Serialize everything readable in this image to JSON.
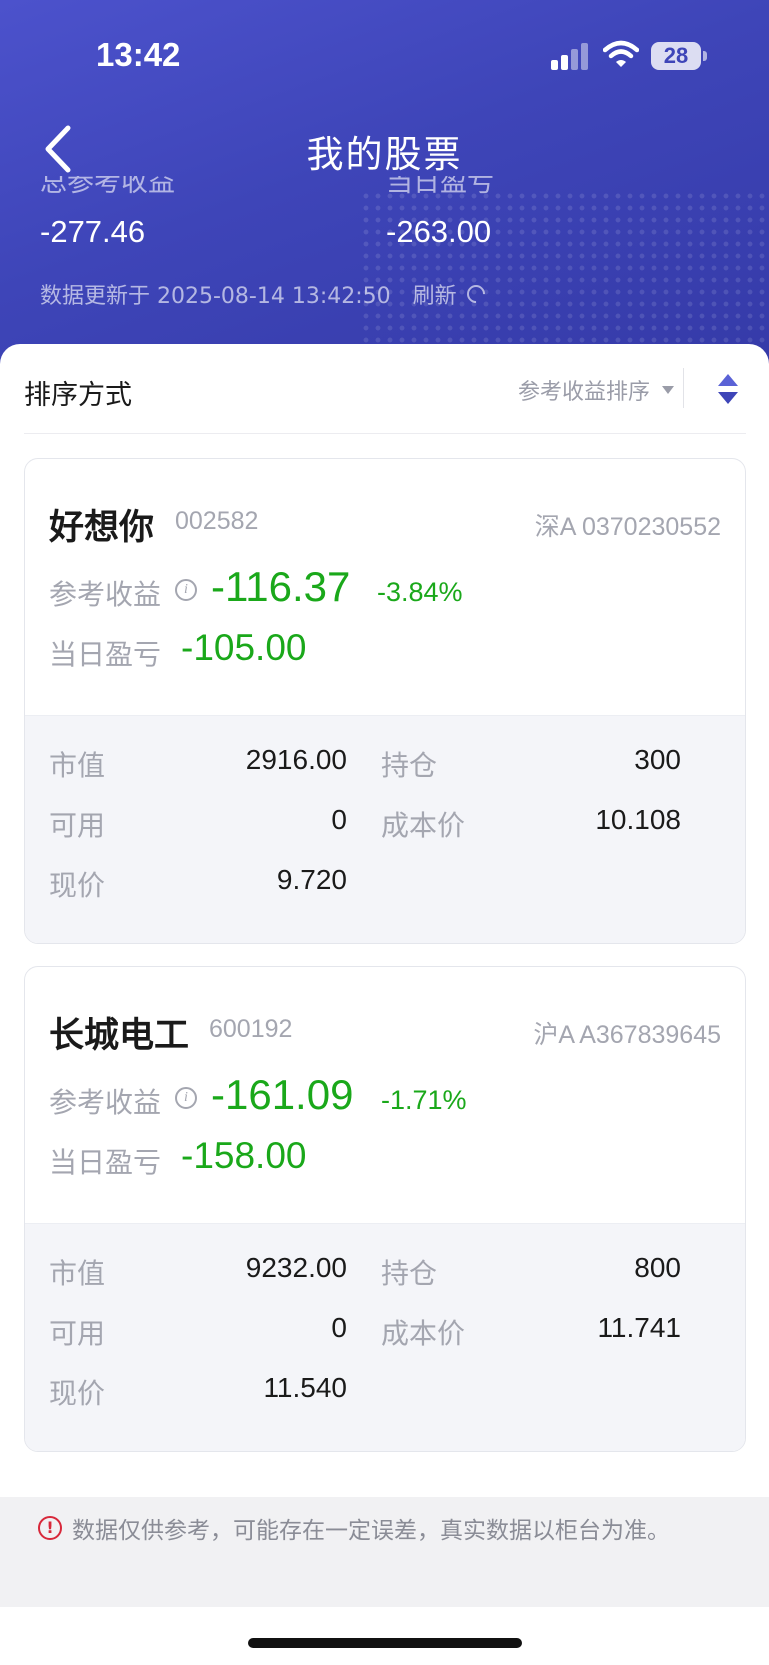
{
  "status_bar": {
    "time": "13:42",
    "battery": "28"
  },
  "header": {
    "title": "我的股票",
    "total_label": "总参考收益",
    "total_value": "-277.46",
    "daily_label": "当日盈亏",
    "daily_value": "-263.00",
    "update_text": "数据更新于 2025-08-14 13:42:50",
    "refresh_label": "刷新"
  },
  "sort": {
    "title": "排序方式",
    "selected": "参考收益排序"
  },
  "stocks": [
    {
      "name": "好想你",
      "code": "002582",
      "account": "深A 0370230552",
      "ref_label": "参考收益",
      "ref_value": "-116.37",
      "ref_pct": "-3.84%",
      "daily_label": "当日盈亏",
      "daily_value": "-105.00",
      "market_value_label": "市值",
      "market_value": "2916.00",
      "position_label": "持仓",
      "position": "300",
      "available_label": "可用",
      "available": "0",
      "cost_label": "成本价",
      "cost": "10.108",
      "price_label": "现价",
      "price": "9.720"
    },
    {
      "name": "长城电工",
      "code": "600192",
      "account": "沪A A367839645",
      "ref_label": "参考收益",
      "ref_value": "-161.09",
      "ref_pct": "-1.71%",
      "daily_label": "当日盈亏",
      "daily_value": "-158.00",
      "market_value_label": "市值",
      "market_value": "9232.00",
      "position_label": "持仓",
      "position": "800",
      "available_label": "可用",
      "available": "0",
      "cost_label": "成本价",
      "cost": "11.741",
      "price_label": "现价",
      "price": "11.540"
    }
  ],
  "notice": {
    "text": "数据仅供参考，可能存在一定误差，真实数据以柜台为准。"
  },
  "colors": {
    "header": "#3e45b8",
    "loss": "#1aa81a",
    "notice_icon": "#d8283a"
  },
  "icons": [
    "back-arrow-icon",
    "signal-icon",
    "wifi-icon",
    "battery-icon",
    "refresh-icon",
    "dropdown-icon",
    "sort-toggle-icon",
    "info-icon",
    "warning-icon"
  ]
}
